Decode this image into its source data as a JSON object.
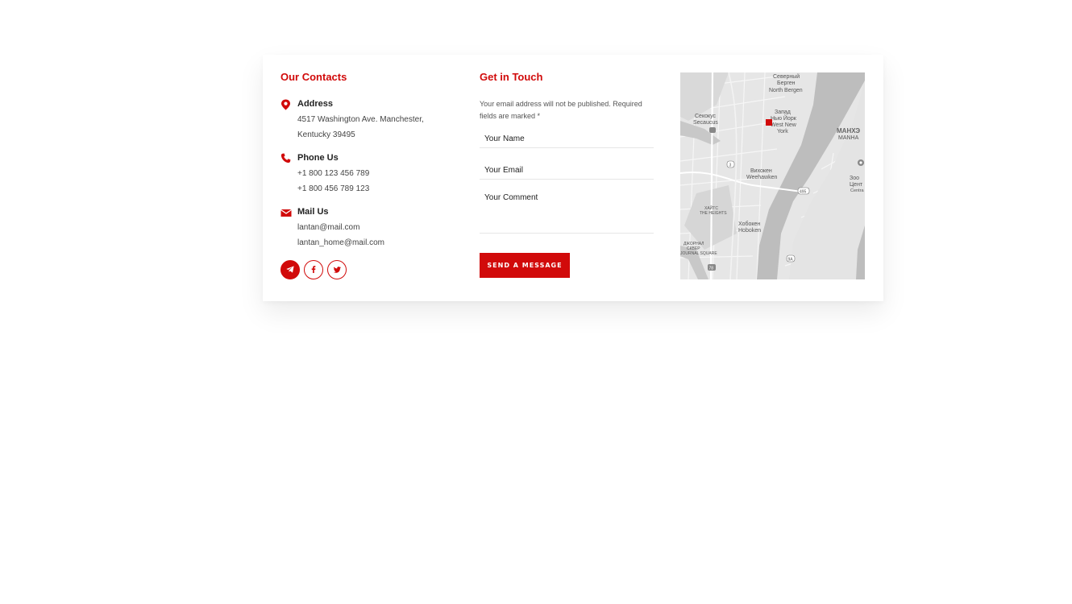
{
  "contacts": {
    "title": "Our Contacts",
    "address": {
      "label": "Address",
      "line1": "4517 Washington Ave. Manchester,",
      "line2": "Kentucky 39495"
    },
    "phone": {
      "label": "Phone Us",
      "line1": "+1 800 123 456 789",
      "line2": "+1 800 456 789 123"
    },
    "mail": {
      "label": "Mail Us",
      "line1": "lantan@mail.com",
      "line2": "lantan_home@mail.com"
    },
    "socials": [
      "telegram-icon",
      "facebook-icon",
      "twitter-icon"
    ]
  },
  "form": {
    "title": "Get in Touch",
    "note": "Your email address will not be published. Required fields are marked *",
    "name_placeholder": "Your Name",
    "email_placeholder": "Your Email",
    "comment_placeholder": "Your Comment",
    "submit_label": "SEND A MESSAGE"
  },
  "map": {
    "labels": {
      "north_bergen_ru1": "Северный",
      "north_bergen_ru2": "Берген",
      "north_bergen": "North Bergen",
      "secaucus_ru": "Секокус",
      "secaucus": "Secaucus",
      "west_ny_ru1": "Запад",
      "west_ny_ru2": "Нью Йорк",
      "west_ny1": "West New",
      "west_ny2": "York",
      "manhattan_ru": "МАНХЭ",
      "manhattan": "MANHA",
      "weehawken_ru": "Вихокен",
      "weehawken": "Weehawken",
      "heights_ru": "ХАЙТС",
      "heights": "THE HEIGHTS",
      "hoboken_ru": "Хобокен",
      "hoboken": "Hoboken",
      "square_ru1": "ДЖОРНАЛ",
      "square_ru2": "СКВЕР",
      "square": "JOURNAL SQUARE",
      "zoo_ru": "Зоо",
      "central_ru": "Цент",
      "central": "Centra",
      "route_495": "495",
      "route_9a": "9A",
      "route_3": "3",
      "route_78": "78"
    },
    "marker_color": "#d10a0a"
  },
  "colors": {
    "accent": "#d10a0a"
  }
}
